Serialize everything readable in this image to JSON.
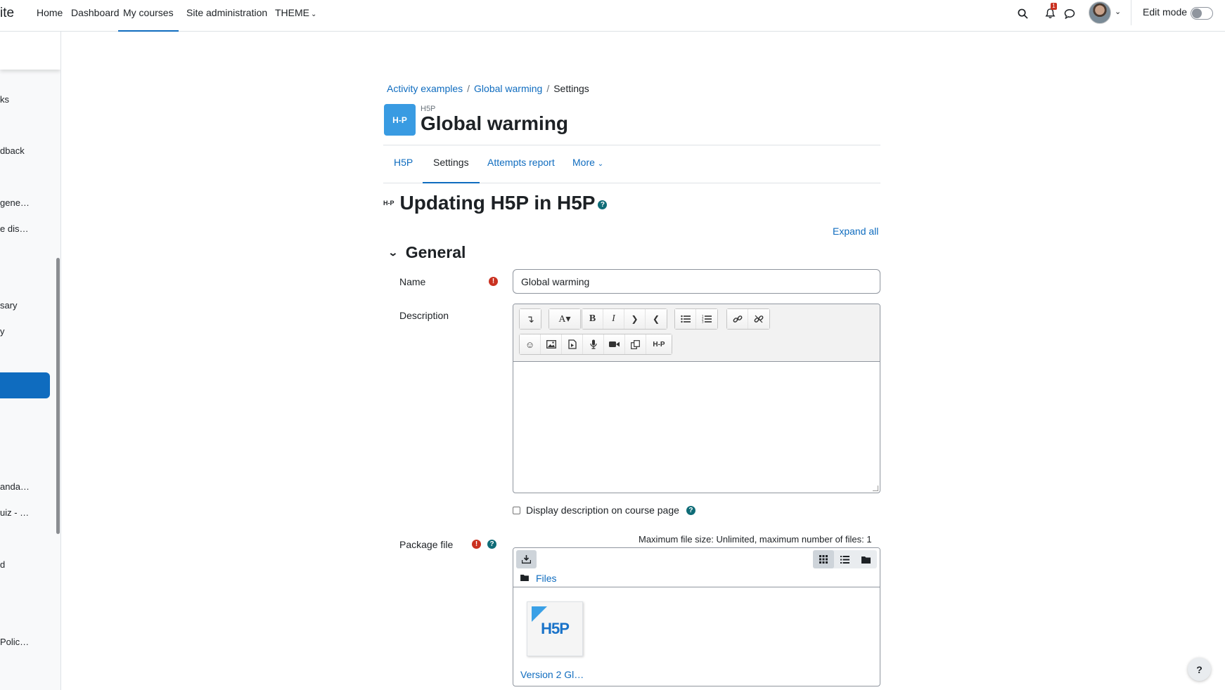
{
  "navbar": {
    "brand": "ite",
    "links": [
      "Home",
      "Dashboard",
      "My courses",
      "Site administration"
    ],
    "theme_label": "THEME",
    "notification_count": "1",
    "edit_mode_label": "Edit mode",
    "edit_mode_on": false
  },
  "drawer": {
    "items": [
      "ks",
      "dback",
      "gene…",
      "e dis…",
      "sary",
      "y",
      "anda…",
      "uiz - …",
      "d",
      "Polic…"
    ]
  },
  "breadcrumb": [
    "Activity examples",
    "Global warming",
    "Settings"
  ],
  "header": {
    "icon_text": "H-P",
    "kicker": "H5P",
    "title": "Global warming"
  },
  "tabs": [
    "H5P",
    "Settings",
    "Attempts report",
    "More"
  ],
  "active_tab": "Settings",
  "form": {
    "heading": "Updating H5P in H5P",
    "heading_icon": "H-P",
    "expand_all": "Expand all",
    "section": "General",
    "name_label": "Name",
    "name_value": "Global warming",
    "description_label": "Description",
    "display_description_label": "Display description on course page",
    "package_label": "Package file",
    "max_size_text": "Maximum file size: Unlimited, maximum number of files: 1",
    "files_path": "Files",
    "file_name": "Version 2 Gl…",
    "file_thumb_text": "H5P"
  },
  "toolbar": {
    "row1": [
      [
        "↴"
      ],
      [
        "A▾"
      ],
      [
        "B",
        "I",
        "❯",
        "❮"
      ],
      [
        "list-ul",
        "list-ol"
      ],
      [
        "link",
        "unlink"
      ]
    ],
    "row2": [
      "emoji",
      "image",
      "media",
      "record-audio",
      "record-video",
      "manage-files",
      "H-P"
    ]
  },
  "help_fab": "?",
  "colors": {
    "accent": "#0f6cbf",
    "h5p_blue": "#399be2",
    "error": "#ca3120"
  }
}
